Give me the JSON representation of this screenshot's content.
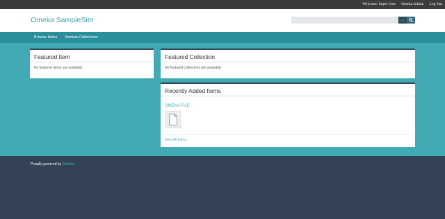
{
  "admin_bar": {
    "welcome": "Welcome, Super User",
    "omeka_admin": "Omeka Admin",
    "log_out": "Log Out"
  },
  "header": {
    "site_title": "Omeka SampleSite",
    "search": {
      "value": "",
      "placeholder": "",
      "options_label": "..."
    }
  },
  "nav": {
    "items": [
      {
        "label": "Browse Items"
      },
      {
        "label": "Browse Collections"
      }
    ]
  },
  "featured_item": {
    "title": "Featured Item",
    "empty_text": "No featured items are available."
  },
  "featured_collection": {
    "title": "Featured Collection",
    "empty_text": "No featured collections are available."
  },
  "recent_items": {
    "title": "Recently Added Items",
    "items": [
      {
        "title": "OMEKA FILE",
        "icon": "file-icon"
      }
    ],
    "view_all": "View All Items"
  },
  "footer": {
    "powered_prefix": "Proudly powered by ",
    "omeka_link": "Omeka",
    "powered_suffix": "."
  },
  "colors": {
    "admin_bar": "#3b3b3b",
    "nav": "#288f9b",
    "main_bg": "#42aab5",
    "footer": "#334254",
    "accent": "#3fb0bd",
    "card_border": "#2f4858"
  }
}
